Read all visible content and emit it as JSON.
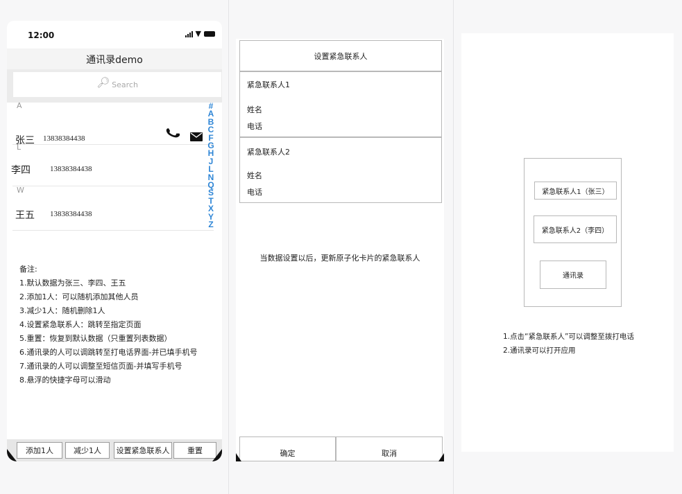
{
  "phone": {
    "status": {
      "time": "12:00"
    },
    "title": "通讯录demo",
    "search": {
      "placeholder": "Search"
    },
    "sections": [
      {
        "letter": "A",
        "contacts": [
          {
            "name": "张三",
            "phone": "13838384438"
          }
        ]
      },
      {
        "letter": "L",
        "contacts": [
          {
            "name": "李四",
            "phone": "13838384438"
          }
        ]
      },
      {
        "letter": "W",
        "contacts": [
          {
            "name": "王五",
            "phone": "13838384438"
          }
        ]
      }
    ],
    "alphabet": [
      "#",
      "A",
      "B",
      "C",
      "F",
      "G",
      "H",
      "J",
      "L",
      "N",
      "Q",
      "S",
      "T",
      "X",
      "Y",
      "Z"
    ],
    "notes": [
      "备注:",
      "1.默认数据为张三、李四、王五",
      "2.添加1人：可以随机添加其他人员",
      "3.减少1人：随机删除1人",
      "4.设置紧急联系人：跳转至指定页面",
      "5.重置：恢复到默认数据（只重置列表数据）",
      "6.通讯录的人可以调跳转至打电话界面-并已填手机号",
      "7.通讯录的人可以调整至短信页面-并填写手机号",
      "8.悬浮的快捷字母可以滑动"
    ],
    "toolbar": {
      "add": "添加1人",
      "remove": "减少1人",
      "set_emergency": "设置紧急联系人",
      "reset": "重置"
    }
  },
  "settings": {
    "title": "设置紧急联系人",
    "cards": [
      {
        "title": "紧急联系人1",
        "name_label": "姓名",
        "phone_label": "电话"
      },
      {
        "title": "紧急联系人2",
        "name_label": "姓名",
        "phone_label": "电话"
      }
    ],
    "note": "当数据设置以后，更新原子化卡片的紧急联系人",
    "confirm": "确定",
    "cancel": "取消"
  },
  "widget": {
    "contact1": "紧急联系人1（张三）",
    "contact2": "紧急联系人2（李四）",
    "open_app": "通讯录",
    "notes": [
      "1.点击“紧急联系人”可以调整至拨打电话",
      "2.通讯录可以打开应用"
    ]
  },
  "colors": {
    "index_blue": "#2f86d6",
    "background": "#f7f7f8",
    "border": "#b8b8b8"
  }
}
